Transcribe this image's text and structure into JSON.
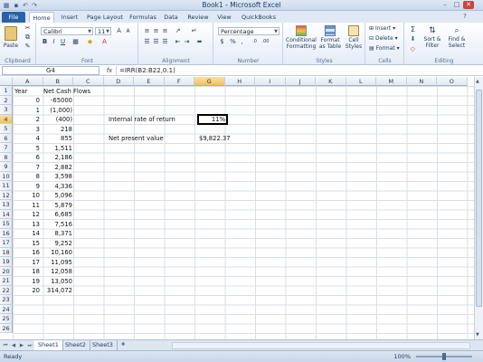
{
  "window": {
    "title": "Book1 - Microsoft Excel",
    "minimize": "–",
    "maximize": "□",
    "close": "✕"
  },
  "qat": {
    "save": "💾",
    "undo": "↶",
    "redo": "↷"
  },
  "tabs": [
    {
      "label": "File"
    },
    {
      "label": "Home"
    },
    {
      "label": "Insert"
    },
    {
      "label": "Page Layout"
    },
    {
      "label": "Formulas"
    },
    {
      "label": "Data"
    },
    {
      "label": "Review"
    },
    {
      "label": "View"
    },
    {
      "label": "QuickBooks"
    }
  ],
  "ribbon": {
    "clipboard": {
      "label": "Clipboard",
      "paste": "Paste"
    },
    "font": {
      "label": "Font",
      "name": "Calibri",
      "size": "11",
      "bold": "B",
      "italic": "I",
      "underline": "U"
    },
    "alignment": {
      "label": "Alignment"
    },
    "number": {
      "label": "Number",
      "format": "Percentage",
      "currency": "$",
      "percent": "%",
      "comma": ","
    },
    "styles": {
      "label": "Styles",
      "conditional": "Conditional Formatting",
      "format_table": "Format as Table",
      "cell_styles": "Cell Styles"
    },
    "cells": {
      "label": "Cells",
      "insert": "Insert",
      "delete": "Delete",
      "format": "Format"
    },
    "editing": {
      "label": "Editing",
      "sort": "Sort & Filter",
      "find": "Find & Select"
    }
  },
  "formula_bar": {
    "name_box": "G4",
    "fx": "fx",
    "formula": "=IRR(B2:B22,0.1)"
  },
  "columns": [
    "A",
    "B",
    "C",
    "D",
    "E",
    "F",
    "G",
    "H",
    "I",
    "J",
    "K",
    "L",
    "M",
    "N",
    "O"
  ],
  "rows": [
    "1",
    "2",
    "3",
    "4",
    "5",
    "6",
    "7",
    "8",
    "9",
    "10",
    "11",
    "12",
    "13",
    "14",
    "15",
    "16",
    "17",
    "18",
    "19",
    "20",
    "21",
    "22",
    "23",
    "24",
    "25",
    "26"
  ],
  "sheet": {
    "header_year": "Year",
    "header_cash": "Net Cash Flows",
    "years": [
      "0",
      "1",
      "2",
      "3",
      "4",
      "5",
      "6",
      "7",
      "8",
      "9",
      "10",
      "11",
      "12",
      "13",
      "14",
      "15",
      "16",
      "17",
      "18",
      "19",
      "20"
    ],
    "cash_flows": [
      "-65000",
      "(1,000)",
      "(400)",
      "218",
      "855",
      "1,511",
      "2,186",
      "2,882",
      "3,598",
      "4,336",
      "5,096",
      "5,879",
      "6,685",
      "7,516",
      "8,371",
      "9,252",
      "10,160",
      "11,095",
      "12,058",
      "13,050",
      "314,072"
    ],
    "irr_label": "Internal rate of return",
    "irr_value": "11%",
    "npv_label": "Net present value",
    "npv_value": "$9,822.37"
  },
  "sheet_tabs": [
    "Sheet1",
    "Sheet2",
    "Sheet3"
  ],
  "status": {
    "ready": "Ready",
    "zoom": "100%"
  }
}
